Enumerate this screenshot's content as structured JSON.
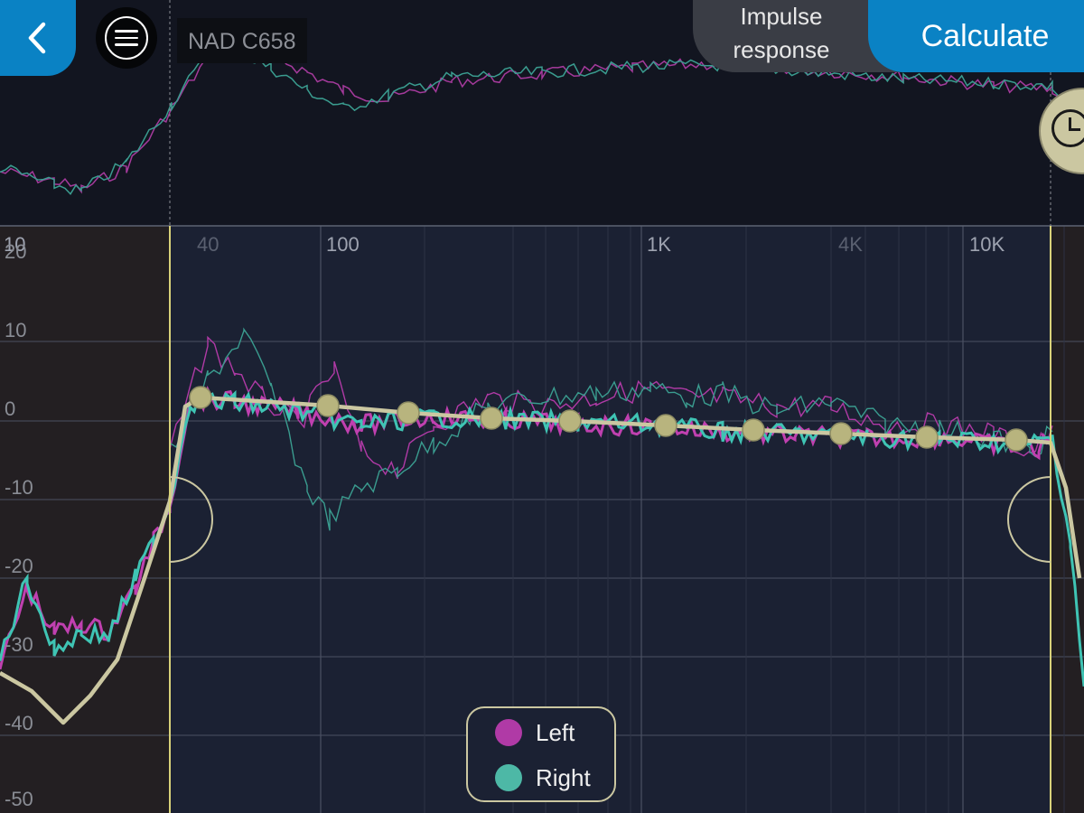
{
  "header": {
    "back_icon": "chevron-left-icon",
    "menu_icon": "hamburger-menu-icon",
    "device_name": "NAD C658",
    "impulse_button": [
      "Impulse",
      "response"
    ],
    "calculate_button": "Calculate",
    "history_icon": "clock-icon"
  },
  "graph": {
    "freq_axis_labels": [
      "10",
      "40",
      "100",
      "1K",
      "4K",
      "10K"
    ],
    "db_axis_labels": [
      "20",
      "10",
      "0",
      "-10",
      "-20",
      "-30",
      "-40",
      "-50"
    ],
    "legend": [
      {
        "label": "Left",
        "color": "#b03aa6"
      },
      {
        "label": "Right",
        "color": "#4db8a6"
      }
    ]
  },
  "colors": {
    "accent": "#0a82c4",
    "target_curve": "#cbc7a1",
    "left_channel": "#c040b0",
    "right_channel": "#3fc4b4",
    "marker_line": "#d9d27a"
  }
}
